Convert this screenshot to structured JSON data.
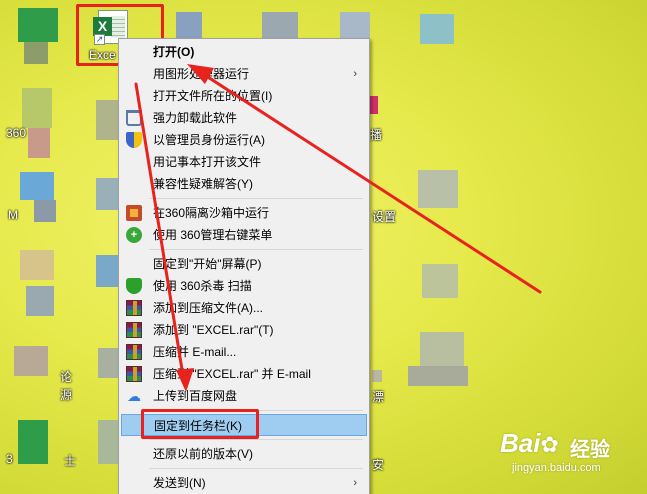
{
  "desktop": {
    "excel_icon": {
      "badge": "X",
      "label": "Exce"
    },
    "partial_labels": [
      {
        "key": "l360",
        "text": "360"
      },
      {
        "key": "lM",
        "text": "M"
      },
      {
        "key": "lbo",
        "text": "播"
      },
      {
        "key": "lshe",
        "text": "设置"
      },
      {
        "key": "llun",
        "text": "论"
      },
      {
        "key": "lyuan",
        "text": "源"
      },
      {
        "key": "lpiao",
        "text": "漂"
      },
      {
        "key": "lan",
        "text": "安"
      },
      {
        "key": "l3",
        "text": "3"
      },
      {
        "key": "lshi",
        "text": "士"
      }
    ]
  },
  "context_menu": {
    "items": [
      {
        "label": "打开(O)",
        "icon": "none",
        "bold": true
      },
      {
        "label": "用图形处理器运行",
        "icon": "none",
        "submenu": "›"
      },
      {
        "label": "打开文件所在的位置(I)",
        "icon": "none"
      },
      {
        "label": "强力卸载此软件",
        "icon": "trash-icon"
      },
      {
        "label": "以管理员身份运行(A)",
        "icon": "uac-shield-icon"
      },
      {
        "label": "用记事本打开该文件",
        "icon": "none"
      },
      {
        "label": "兼容性疑难解答(Y)",
        "icon": "none"
      },
      {
        "label": "在360隔离沙箱中运行",
        "icon": "sandbox-icon"
      },
      {
        "label": "使用 360管理右键菜单",
        "icon": "360-plus-icon"
      },
      {
        "label": "固定到\"开始\"屏幕(P)",
        "icon": "none"
      },
      {
        "label": "使用 360杀毒 扫描",
        "icon": "360-shield-icon"
      },
      {
        "label": "添加到压缩文件(A)...",
        "icon": "winrar-icon"
      },
      {
        "label": "添加到 \"EXCEL.rar\"(T)",
        "icon": "winrar-icon"
      },
      {
        "label": "压缩并 E-mail...",
        "icon": "winrar-icon"
      },
      {
        "label": "压缩到 \"EXCEL.rar\" 并 E-mail",
        "icon": "winrar-icon"
      },
      {
        "label": "上传到百度网盘",
        "icon": "baidu-netdisk-icon"
      },
      {
        "label": "固定到任务栏(K)",
        "icon": "none",
        "highlighted": true
      },
      {
        "label": "还原以前的版本(V)",
        "icon": "none"
      },
      {
        "label": "发送到(N)",
        "icon": "none",
        "submenu": "›"
      }
    ]
  },
  "watermark": {
    "logo": "Bai",
    "logo2": "经验",
    "url": "jingyan.baidu.com"
  },
  "colors": {
    "annotation_red": "#e8231e",
    "highlight": "#9fcdf1",
    "desktop_yellow": "#e6ea4c"
  }
}
